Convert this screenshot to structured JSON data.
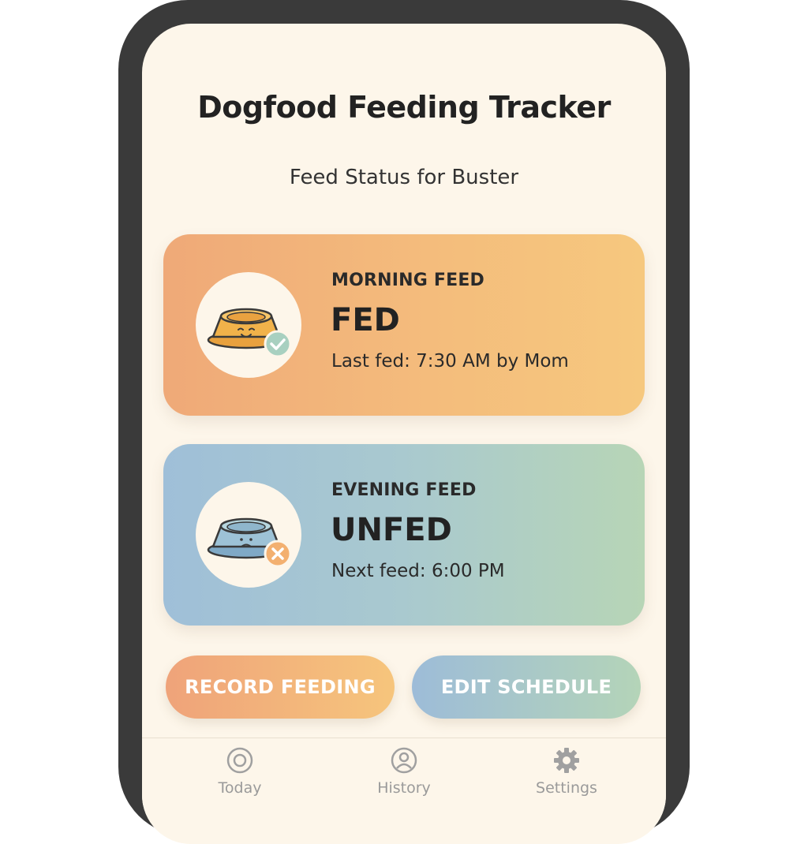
{
  "app": {
    "title": "Dogfood Feeding Tracker",
    "subtitle": "Feed Status for Buster"
  },
  "cards": {
    "morning": {
      "label": "MORNING FEED",
      "status": "FED",
      "detail": "Last fed: 7:30 AM by Mom",
      "icon": "happy-bowl-check-icon"
    },
    "evening": {
      "label": "EVENING FEED",
      "status": "UNFED",
      "detail": "Next feed: 6:00 PM",
      "icon": "sad-bowl-x-icon"
    }
  },
  "actions": {
    "record_label": "RECORD FEEDING",
    "edit_label": "EDIT SCHEDULE"
  },
  "nav": {
    "items": [
      {
        "label": "Today",
        "icon": "target-circle-icon"
      },
      {
        "label": "History",
        "icon": "profile-circle-icon"
      },
      {
        "label": "Settings",
        "icon": "gear-icon"
      }
    ]
  },
  "colors": {
    "screen_bg": "#fdf6ea",
    "phone_frame": "#3a3a3a",
    "morning_start": "#efa978",
    "morning_end": "#f6c87e",
    "evening_start": "#9fbfd8",
    "evening_end": "#b7d5b6",
    "check_badge": "#a8d0c0",
    "x_badge": "#f3b070"
  }
}
